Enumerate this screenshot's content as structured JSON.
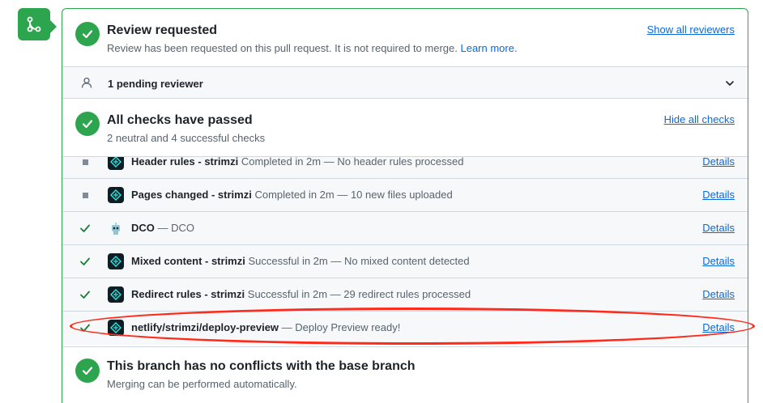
{
  "review": {
    "title": "Review requested",
    "subtitle": "Review has been requested on this pull request. It is not required to merge.",
    "learn_more": "Learn more.",
    "show_all_reviewers": "Show all reviewers",
    "pending": "1 pending reviewer"
  },
  "checks": {
    "title": "All checks have passed",
    "subtitle": "2 neutral and 4 successful checks",
    "hide_all": "Hide all checks",
    "details_label": "Details",
    "items": [
      {
        "name": "Header rules - strimzi",
        "description": "Completed in 2m — No header rules processed",
        "status": "neutral",
        "app": "netlify"
      },
      {
        "name": "Pages changed - strimzi",
        "description": "Completed in 2m — 10 new files uploaded",
        "status": "neutral",
        "app": "netlify"
      },
      {
        "name": "DCO",
        "description": "— DCO",
        "status": "success",
        "app": "dco"
      },
      {
        "name": "Mixed content - strimzi",
        "description": "Successful in 2m — No mixed content detected",
        "status": "success",
        "app": "netlify"
      },
      {
        "name": "Redirect rules - strimzi",
        "description": "Successful in 2m — 29 redirect rules processed",
        "status": "success",
        "app": "netlify"
      },
      {
        "name": "netlify/strimzi/deploy-preview",
        "description": "— Deploy Preview ready!",
        "status": "success",
        "app": "netlify"
      }
    ]
  },
  "branch": {
    "title": "This branch has no conflicts with the base branch",
    "subtitle": "Merging can be performed automatically."
  },
  "colors": {
    "success": "#2da44e",
    "link": "#0969da",
    "highlight": "#ff2a1a"
  }
}
